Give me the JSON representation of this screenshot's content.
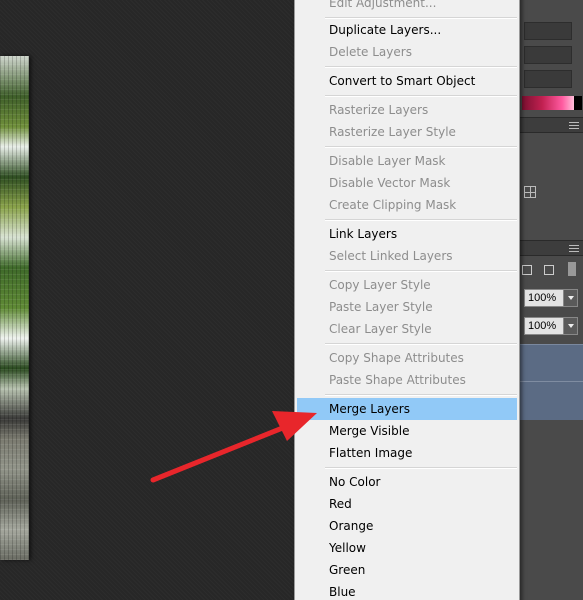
{
  "menu": {
    "items": [
      {
        "label": "Edit Adjustment...",
        "enabled": false
      },
      {
        "label": "Duplicate Layers...",
        "enabled": true
      },
      {
        "label": "Delete Layers",
        "enabled": false
      },
      {
        "label": "Convert to Smart Object",
        "enabled": true
      },
      {
        "label": "Rasterize Layers",
        "enabled": false
      },
      {
        "label": "Rasterize Layer Style",
        "enabled": false
      },
      {
        "label": "Disable Layer Mask",
        "enabled": false
      },
      {
        "label": "Disable Vector Mask",
        "enabled": false
      },
      {
        "label": "Create Clipping Mask",
        "enabled": false
      },
      {
        "label": "Link Layers",
        "enabled": true
      },
      {
        "label": "Select Linked Layers",
        "enabled": false
      },
      {
        "label": "Copy Layer Style",
        "enabled": false
      },
      {
        "label": "Paste Layer Style",
        "enabled": false
      },
      {
        "label": "Clear Layer Style",
        "enabled": false
      },
      {
        "label": "Copy Shape Attributes",
        "enabled": false
      },
      {
        "label": "Paste Shape Attributes",
        "enabled": false
      },
      {
        "label": "Merge Layers",
        "enabled": true,
        "highlighted": true
      },
      {
        "label": "Merge Visible",
        "enabled": true
      },
      {
        "label": "Flatten Image",
        "enabled": true
      },
      {
        "label": "No Color",
        "enabled": true
      },
      {
        "label": "Red",
        "enabled": true
      },
      {
        "label": "Orange",
        "enabled": true
      },
      {
        "label": "Yellow",
        "enabled": true
      },
      {
        "label": "Green",
        "enabled": true
      },
      {
        "label": "Blue",
        "enabled": true
      }
    ]
  },
  "panels": {
    "opacity_value": "100%",
    "fill_value": "100%"
  },
  "colors": {
    "highlight": "#91c9f7",
    "annotation_arrow": "#e8262b",
    "selected_layer": "#5b6b84"
  },
  "icons": {
    "panel_menu": "panel-menu-icon",
    "grid": "grid-icon",
    "annotation": "red-arrow-icon"
  }
}
